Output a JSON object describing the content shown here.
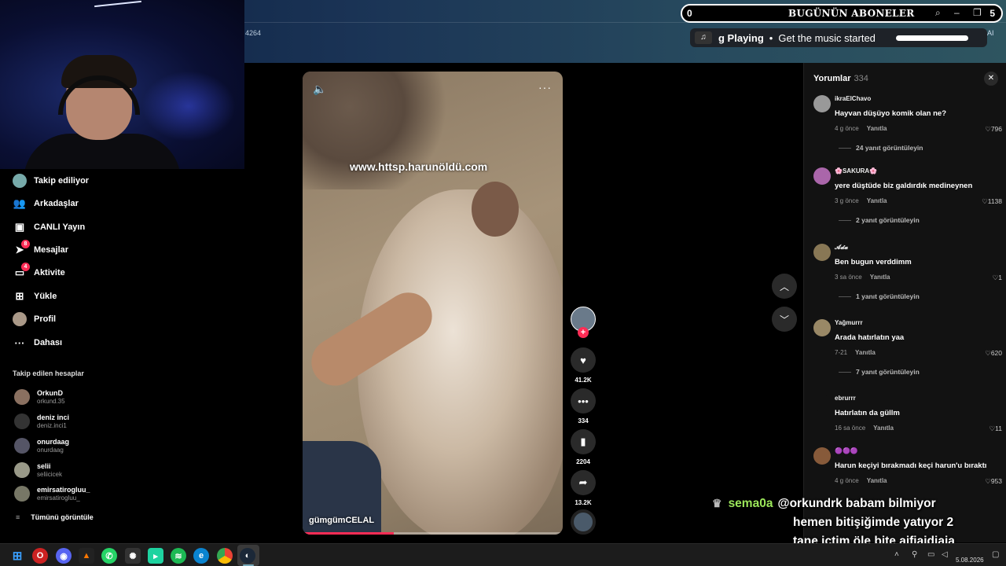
{
  "subs_bar": {
    "left_count": "0",
    "title": "BUGÜNÜN ABONELER",
    "right_count": "5"
  },
  "music": {
    "playing": "g Playing",
    "song": "Get the music started"
  },
  "top": {
    "url_fragment": "4264",
    "ai_label": "AI"
  },
  "sidebar": {
    "items": [
      {
        "label": "Takip ediliyor",
        "icon": "following-avatar-icon"
      },
      {
        "label": "Arkadaşlar",
        "icon": "friends-icon"
      },
      {
        "label": "CANLI Yayın",
        "icon": "live-icon"
      },
      {
        "label": "Mesajlar",
        "icon": "messages-icon",
        "badge": "8"
      },
      {
        "label": "Aktivite",
        "icon": "activity-icon",
        "badge": "4"
      },
      {
        "label": "Yükle",
        "icon": "upload-icon"
      },
      {
        "label": "Profil",
        "icon": "profile-avatar-icon"
      },
      {
        "label": "Dahası",
        "icon": "more-icon"
      }
    ],
    "section_title": "Takip edilen hesaplar",
    "accounts": [
      {
        "name": "OrkunD",
        "handle": "orkund.35"
      },
      {
        "name": "deniz inci",
        "handle": "deniz.inci1"
      },
      {
        "name": "onurdaag",
        "handle": "onurdaag"
      },
      {
        "name": "selii",
        "handle": "seliicicek"
      },
      {
        "name": "emirsatirogluu_",
        "handle": "emirsatirogluu_"
      }
    ],
    "see_all": "Tümünü görüntüle"
  },
  "video": {
    "watermark": "www.httsp.harunöldü.com",
    "author": "gümgümCELAL",
    "progress": 0.35
  },
  "actions": {
    "likes": "41.2K",
    "comments": "334",
    "saves": "2204",
    "shares": "13.2K"
  },
  "comments_panel": {
    "title": "Yorumlar",
    "count": "334",
    "items": [
      {
        "user": "ikraElChavo",
        "text": "Hayvan düşüyo komik olan ne?",
        "time": "4 g önce",
        "reply": "Yanıtla",
        "likes": "796",
        "replies": "24 yanıt görüntüleyin"
      },
      {
        "user": "🌸SAKURA🌸",
        "text": "yere düştüde biz galdırdık medineynen",
        "time": "3 g önce",
        "reply": "Yanıtla",
        "likes": "1138",
        "replies": "2 yanıt görüntüleyin"
      },
      {
        "user": "𝓐𝓭𝓪",
        "text": "Ben bugun verddimm",
        "time": "3 sa önce",
        "reply": "Yanıtla",
        "likes": "1",
        "replies": "1 yanıt görüntüleyin"
      },
      {
        "user": "Yağmurrr",
        "text": "Arada hatırlatın yaa",
        "time": "7-21",
        "reply": "Yanıtla",
        "likes": "620",
        "replies": "7 yanıt görüntüleyin"
      },
      {
        "user": "ebrurrr",
        "text": "Hatırlatın da güllm",
        "time": "16 sa önce",
        "reply": "Yanıtla",
        "likes": "11",
        "replies": ""
      },
      {
        "user": "🟣🟣🟣",
        "text": "Harun keçiyi bırakmadı keçi harun'u bıraktı",
        "time": "4 g önce",
        "reply": "Yanıtla",
        "likes": "953",
        "replies": ""
      }
    ]
  },
  "chat": {
    "user": "sema0a",
    "line1": "@orkundrk babam bilmiyor",
    "line2": "hemen bitişiğimde yatıyor 2",
    "line3": "tane içtim öle bite ajfjajdjaja"
  },
  "taskbar": {
    "date": "5.08.2026"
  }
}
